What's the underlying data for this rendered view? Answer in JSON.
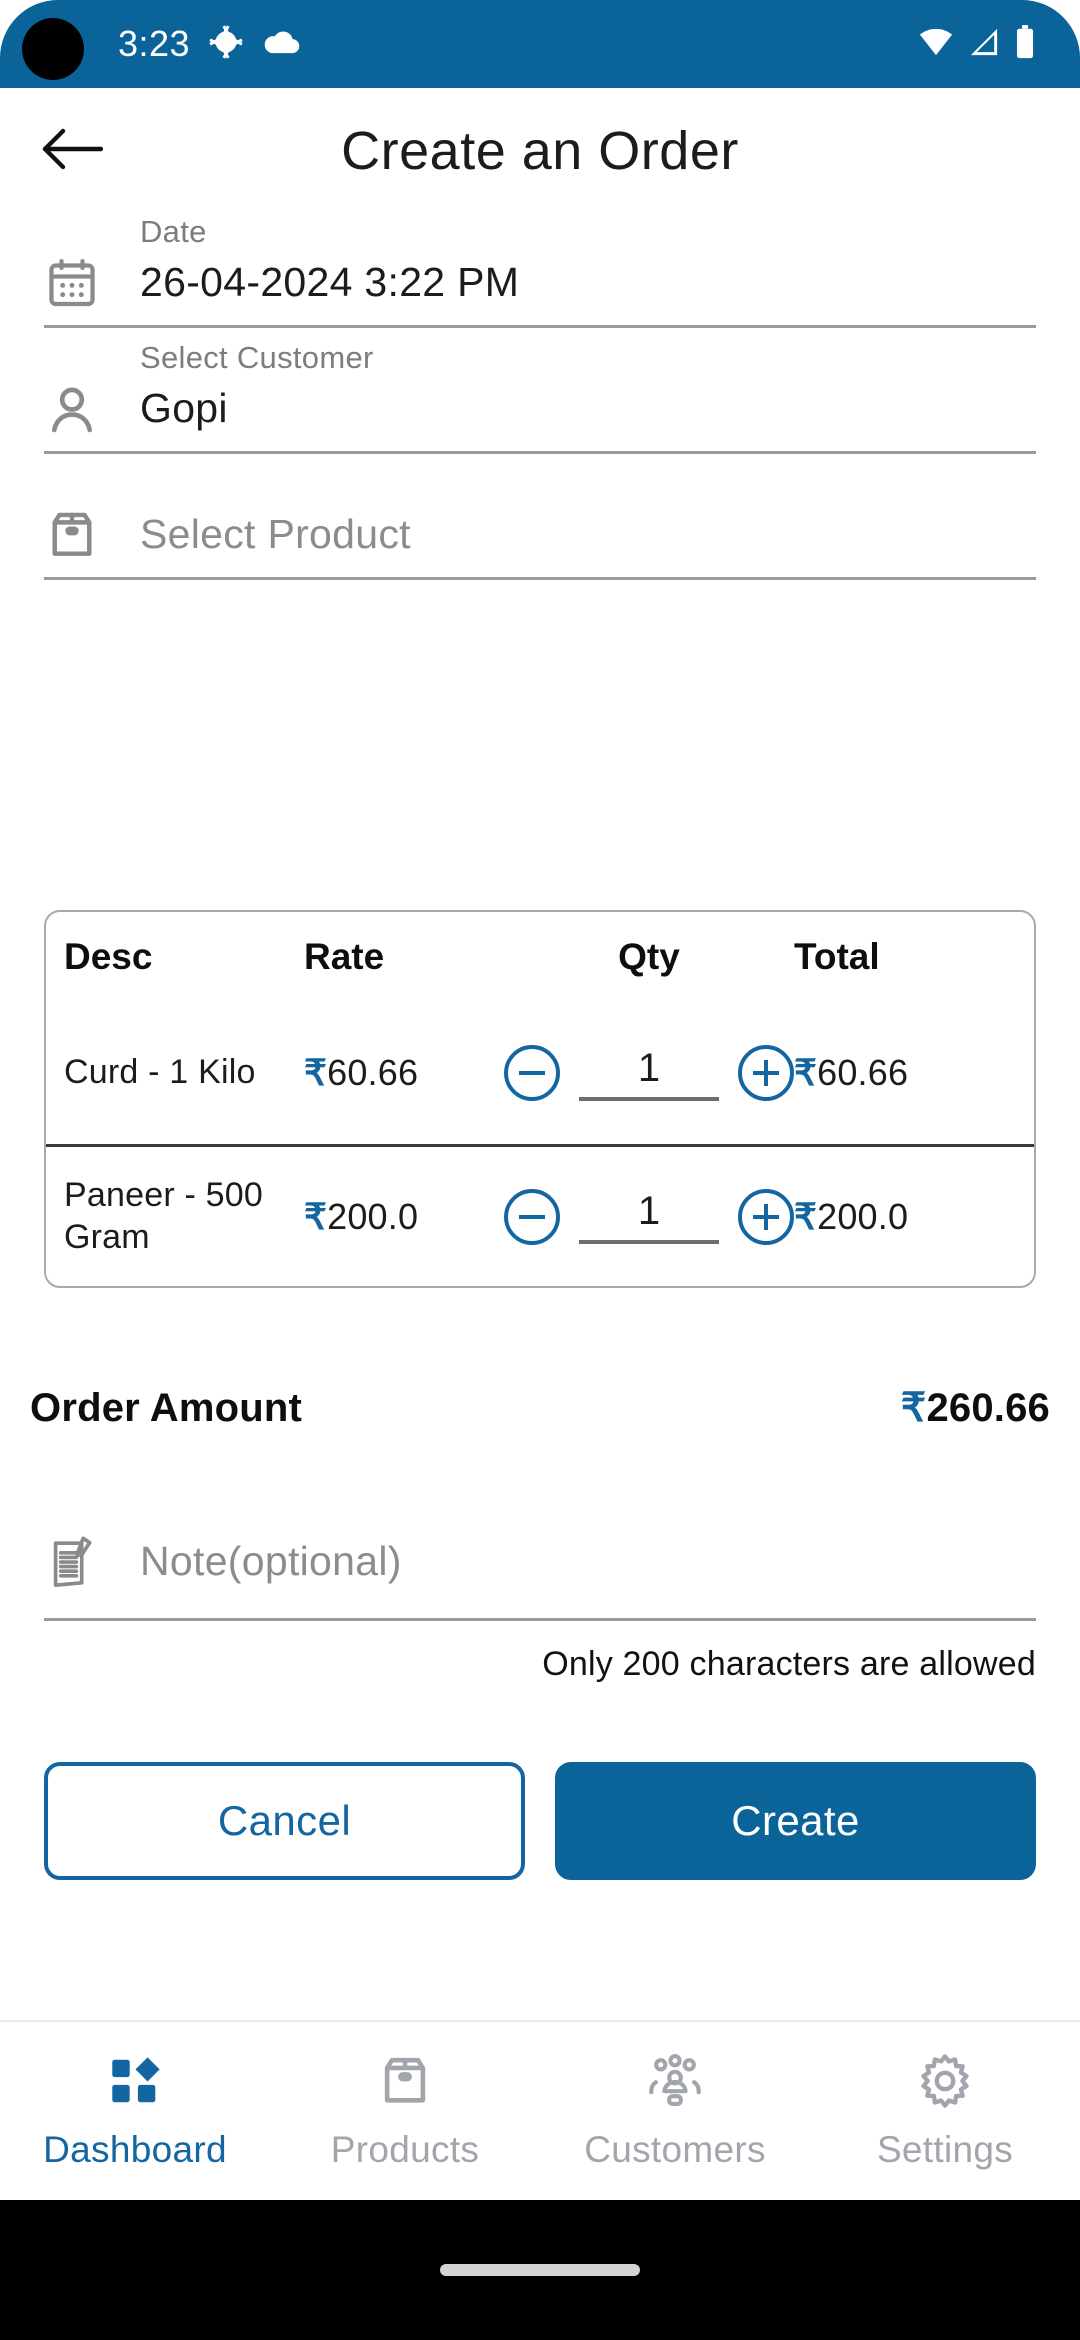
{
  "theme": {
    "primary": "#0b6499",
    "accent": "#1366a1",
    "muted": "#8c8c8c",
    "line": "#9a9a9a"
  },
  "status_bar": {
    "time": "3:23",
    "icons": [
      "android-bug-icon",
      "cloud-icon",
      "wifi-icon",
      "cellular-signal-icon",
      "battery-icon"
    ]
  },
  "app_bar": {
    "back_icon": "arrow-left-icon",
    "title": "Create an Order"
  },
  "form": {
    "date": {
      "icon": "calendar-icon",
      "label": "Date",
      "value": "26-04-2024 3:22 PM"
    },
    "customer": {
      "icon": "person-icon",
      "label": "Select Customer",
      "value": "Gopi"
    },
    "product": {
      "icon": "package-box-icon",
      "placeholder": "Select Product",
      "value": ""
    },
    "note": {
      "icon": "note-pencil-icon",
      "placeholder": "Note(optional)",
      "value": "",
      "hint": "Only 200 characters are allowed"
    }
  },
  "items_table": {
    "columns": [
      "Desc",
      "Rate",
      "Qty",
      "Total"
    ],
    "currency_symbol": "₹",
    "rows": [
      {
        "desc": "Curd - 1 Kilo",
        "rate": "60.66",
        "qty": "1",
        "total": "60.66",
        "decrement_icon": "minus-circle-icon",
        "increment_icon": "plus-circle-icon"
      },
      {
        "desc": "Paneer - 500 Gram",
        "rate": "200.0",
        "qty": "1",
        "total": "200.0",
        "decrement_icon": "minus-circle-icon",
        "increment_icon": "plus-circle-icon"
      }
    ]
  },
  "order_amount": {
    "label": "Order Amount",
    "value": "260.66"
  },
  "actions": {
    "cancel_label": "Cancel",
    "create_label": "Create"
  },
  "bottom_nav": {
    "active_index": 0,
    "items": [
      {
        "label": "Dashboard",
        "icon": "dashboard-grid-icon"
      },
      {
        "label": "Products",
        "icon": "package-box-icon"
      },
      {
        "label": "Customers",
        "icon": "customers-group-icon"
      },
      {
        "label": "Settings",
        "icon": "gear-icon"
      }
    ]
  }
}
